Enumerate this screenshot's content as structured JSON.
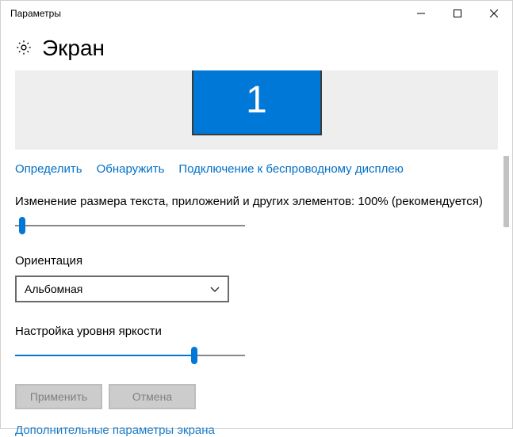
{
  "window": {
    "title": "Параметры"
  },
  "header": {
    "title": "Экран"
  },
  "display": {
    "monitor_number": "1"
  },
  "links": {
    "detect": "Определить",
    "identify": "Обнаружить",
    "wireless": "Подключение к беспроводному дисплею"
  },
  "scale": {
    "label": "Изменение размера текста, приложений и других элементов: 100% (рекомендуется)",
    "value_percent": 0
  },
  "orientation": {
    "label": "Ориентация",
    "selected": "Альбомная"
  },
  "brightness": {
    "label": "Настройка уровня яркости",
    "value_percent": 78
  },
  "buttons": {
    "apply": "Применить",
    "cancel": "Отмена"
  },
  "footer": {
    "more": "Дополнительные параметры экрана"
  }
}
